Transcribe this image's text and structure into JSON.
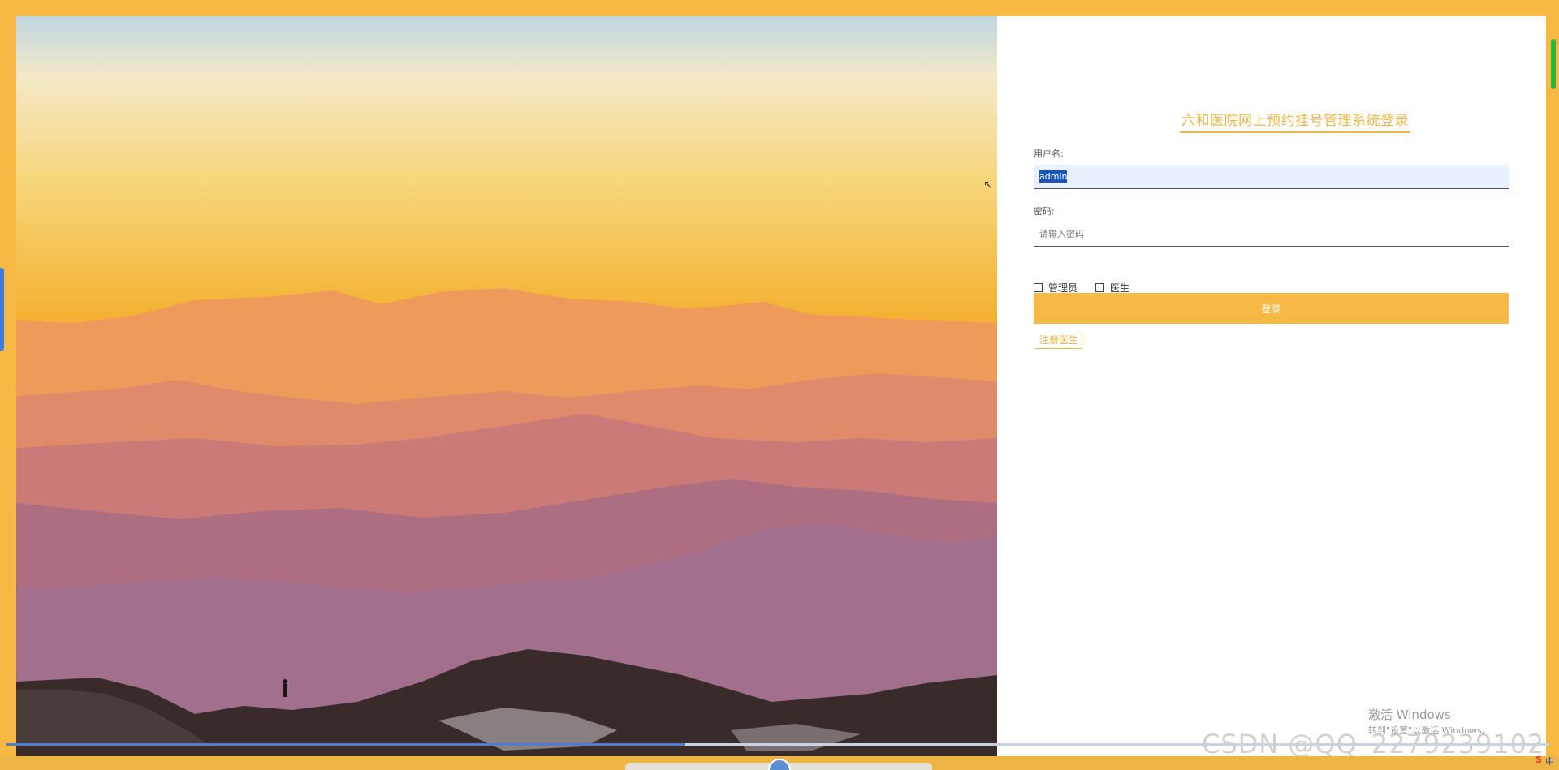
{
  "login": {
    "title": "六和医院网上预约挂号管理系统登录",
    "username_label": "用户名:",
    "username_value": "admin",
    "password_label": "密码:",
    "password_placeholder": "请输入密码",
    "roles": [
      "管理员",
      "医生"
    ],
    "login_button": "登录",
    "register_link": "注册医生"
  },
  "overlays": {
    "windows_activation_title": "激活 Windows",
    "windows_activation_hint": "转到\"设置\"以激活 Windows。",
    "csdn_watermark": "CSDN @QQ_2279239102"
  },
  "video_progress": 0.44,
  "colors": {
    "accent": "#f0b544",
    "button": "#f8b845",
    "background": "#f7b944"
  },
  "icons": {
    "role_checkbox": "checkbox-icon",
    "mouse_cursor": "cursor-arrow-icon",
    "tray_input_method": "sogou-s-icon"
  },
  "tray": {
    "input_lang": "中"
  }
}
